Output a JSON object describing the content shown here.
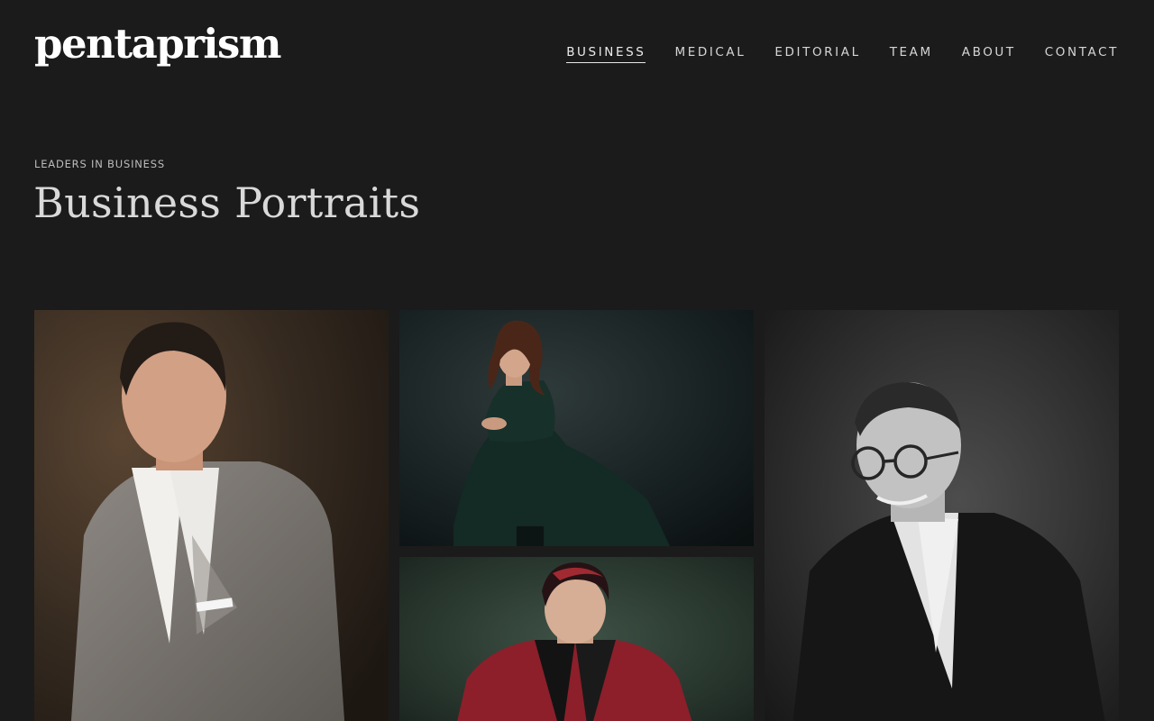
{
  "brand": {
    "logo_text": "pentaprism"
  },
  "nav": {
    "items": [
      {
        "label": "BUSINESS",
        "active": true
      },
      {
        "label": "MEDICAL",
        "active": false
      },
      {
        "label": "EDITORIAL",
        "active": false
      },
      {
        "label": "TEAM",
        "active": false
      },
      {
        "label": "ABOUT",
        "active": false
      },
      {
        "label": "CONTACT",
        "active": false
      }
    ]
  },
  "hero": {
    "eyebrow": "LEADERS IN BUSINESS",
    "title": "Business Portraits"
  },
  "gallery": {
    "photos": [
      {
        "subject": "man-in-grey-suit-portrait"
      },
      {
        "subject": "woman-in-green-dress-seated-portrait"
      },
      {
        "subject": "woman-in-red-blazer-portrait"
      },
      {
        "subject": "man-with-glasses-black-and-white-portrait"
      }
    ]
  },
  "colors": {
    "background": "#1b1b1b",
    "logo": "#ffffff",
    "nav_text": "#d6d6d6",
    "title_text": "#d9d9d9"
  }
}
